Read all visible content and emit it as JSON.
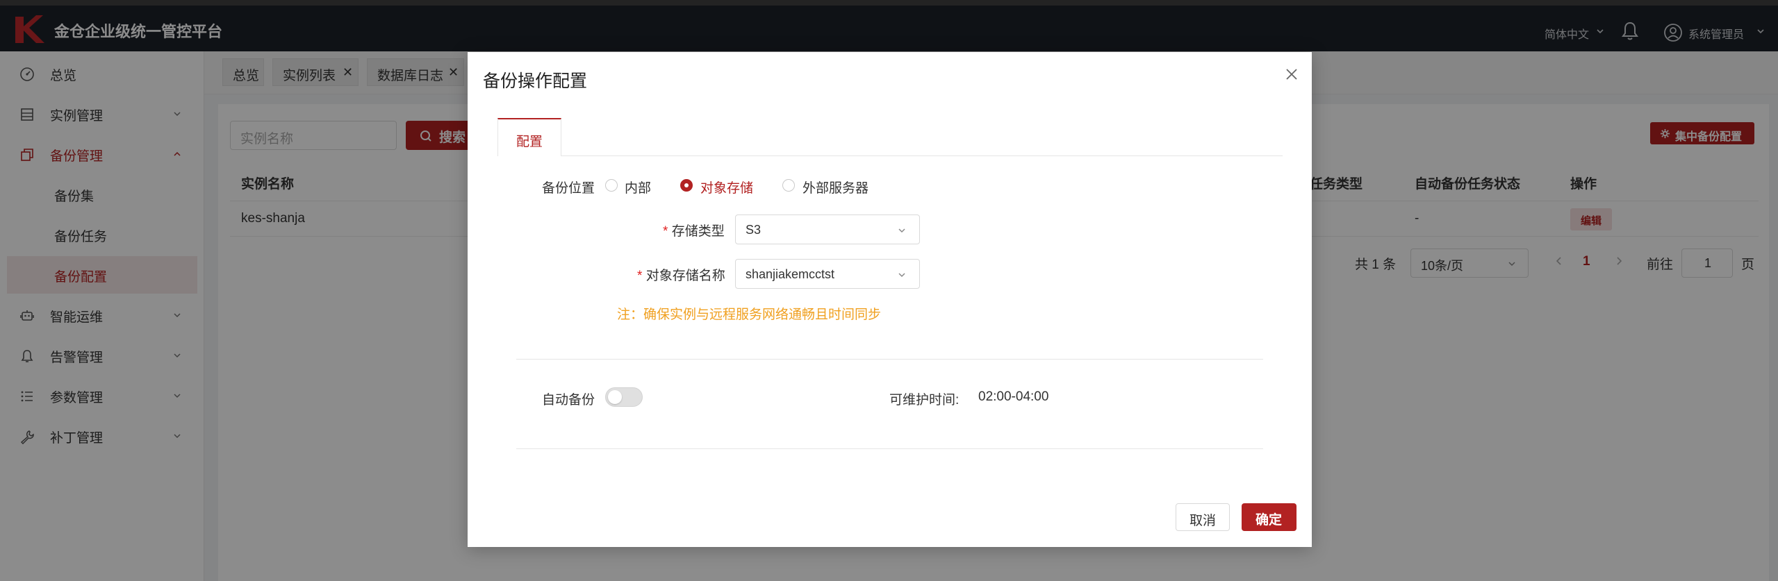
{
  "header": {
    "app_title": "金仓企业级统一管控平台",
    "language": "简体中文",
    "user": "系统管理员"
  },
  "sidebar": {
    "items": [
      {
        "label": "总览",
        "icon": "dashboard-icon"
      },
      {
        "label": "实例管理",
        "icon": "list-icon"
      },
      {
        "label": "备份管理",
        "icon": "copy-icon"
      },
      {
        "label": "智能运维",
        "icon": "robot-icon"
      },
      {
        "label": "告警管理",
        "icon": "bell-icon"
      },
      {
        "label": "参数管理",
        "icon": "list-bullets-icon"
      },
      {
        "label": "补丁管理",
        "icon": "wrench-icon"
      }
    ],
    "sub_items": [
      {
        "label": "备份集"
      },
      {
        "label": "备份任务"
      },
      {
        "label": "备份配置"
      }
    ]
  },
  "tabs": [
    {
      "label": "总览"
    },
    {
      "label": "实例列表"
    },
    {
      "label": "数据库日志"
    }
  ],
  "filter": {
    "search_placeholder": "实例名称",
    "search_button": "搜索",
    "batch_button": "集中备份配置"
  },
  "table": {
    "columns": [
      "实例名称",
      "任务类型",
      "自动备份任务状态",
      "操作"
    ],
    "rows": [
      {
        "instance": "kes-shanja",
        "auto_backup_status": "-",
        "action": "编辑"
      }
    ]
  },
  "pagination": {
    "total": "共 1 条",
    "page_size": "10条/页",
    "current_page": "1",
    "goto_label": "前往",
    "goto_value": "1",
    "page_suffix": "页"
  },
  "modal": {
    "title": "备份操作配置",
    "tab": "配置",
    "location_label": "备份位置",
    "location_options": [
      "内部",
      "对象存储",
      "外部服务器"
    ],
    "location_selected": "对象存储",
    "storage_type_label": "存储类型",
    "storage_type_value": "S3",
    "storage_name_label": "对象存储名称",
    "storage_name_value": "shanjiakemcctst",
    "note": "注：确保实例与远程服务网络通畅且时间同步",
    "auto_backup_label": "自动备份",
    "auto_backup_on": false,
    "maintenance_label": "可维护时间:",
    "maintenance_value": "02:00-04:00",
    "cancel": "取消",
    "confirm": "确定"
  },
  "colors": {
    "accent": "#b22222",
    "header_bg": "#1d2129",
    "note": "#f0a020"
  }
}
